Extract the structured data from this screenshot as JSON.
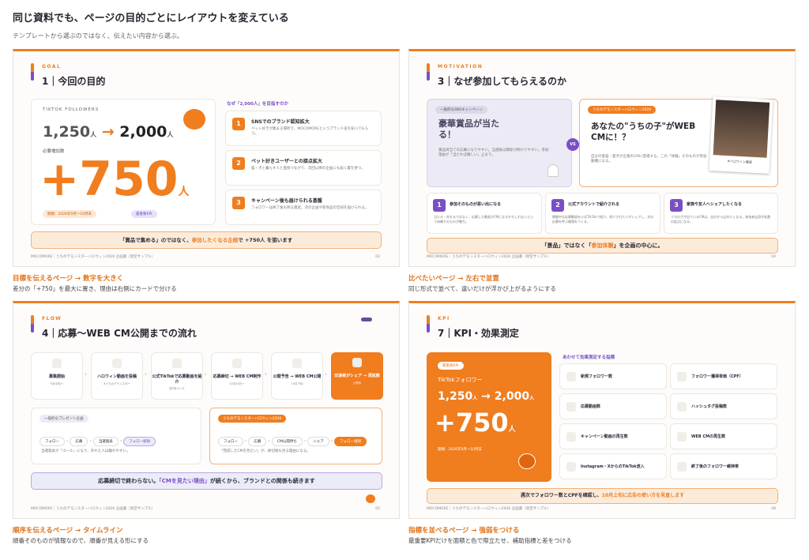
{
  "header": {
    "title": "同じ資料でも、ページの目的ごとにレイアウトを変えている",
    "subtitle": "テンプレートから選ぶのではなく、伝えたい内容から選ぶ。"
  },
  "footer": "MOCOMORE｜うちのデモンスターハロウィン2026 企画書（架空サンプル）",
  "s1": {
    "kicker": "GOAL",
    "title": "1｜今回の目的",
    "label": "TIKTOK FOLLOWERS",
    "from": "1,250",
    "unit": "人",
    "to": "2,000",
    "need_label": "必要増加数",
    "big": "+750",
    "period": "期間：2026年9月〜10月末",
    "kpi": "最重要KPI",
    "reasons_title": "なぜ「2,000人」を目指すのか",
    "items": [
      {
        "n": "1",
        "t": "SNSでのブランド認知拡大",
        "d": "ペット好きが集まる場所で、MOCOMOREというブランド名を知ってもらう。"
      },
      {
        "n": "2",
        "t": "ペット好きユーザーとの接点拡大",
        "d": "猫・犬と暮らす人と直接つながり、次回以降の企画にも届く層を持つ。"
      },
      {
        "n": "3",
        "t": "キャンペーン後も届けられる基盤",
        "d": "フォロワーは終了後も残る資産。次の企画や新商品の告知を届けられる。"
      }
    ],
    "banner_a": "「賞品で集める」のではなく、",
    "banner_b": "参加したくなる企画",
    "banner_c": "で +750人 を狙います",
    "page": "02"
  },
  "s2": {
    "kicker": "MOTIVATION",
    "title": "3｜なぜ参加してもらえるのか",
    "left_pill": "一般的なSNSキャンペーン",
    "left_head": "豪華賞品が当たる！",
    "left_desc": "賞品目当ての応募になりやすい。当選後は関係が終わりやすい。参加理由が「当たれば嬉しい」止まり。",
    "vs": "VS",
    "right_pill": "うちのデモンスターハロウィン2026",
    "right_head": "あなたの\"うちの子\"がWEB CMに！？",
    "right_desc": "自分の愛猫・愛犬が企業のCMに登場する。この「体験」そのものが参加動機になる。",
    "photo_cap": "#ハロウィン審査",
    "items": [
      {
        "n": "1",
        "t": "参加そのものが思い出になる",
        "d": "当たる・外れるではなく、応募した動画がCMになるかもしれないという体験そのものが魅力。"
      },
      {
        "n": "2",
        "t": "公式アカウントで紹介される",
        "d": "期間中は応募動画を公式TikTokで紹介。紹介された人がシェアし、次の応募を呼ぶ循環をつくる。"
      },
      {
        "n": "3",
        "t": "家族や友人へシェアしたくなる",
        "d": "うちの子が出ているCMは、自分から広めたくなる。参加者自身が拡散の起点になる。"
      }
    ],
    "banner_a": "「景品」ではなく「",
    "banner_b": "参加体験",
    "banner_c": "」を企画の中心に。",
    "page": "04"
  },
  "s3": {
    "kicker": "FLOW",
    "title": "4｜応募〜WEB CM公開までの流れ",
    "steps": [
      {
        "t": "募集開始",
        "d": "9月中旬〜"
      },
      {
        "t": "ハロウィン動画を投稿",
        "d": "#うちのデモンスター"
      },
      {
        "t": "公式TikTokで応募動画を紹介",
        "d": "週3本ペース"
      },
      {
        "t": "応募締切 → WEB CM制作",
        "d": "10月20日〜"
      },
      {
        "t": "公開予告 → WEB CM公開",
        "d": "10月下旬"
      },
      {
        "t": "出演者がシェア → 再拡散",
        "d": "公開後"
      }
    ],
    "left_pill": "一般的なプレゼント企画",
    "left_chain": [
      "フォロー",
      "応募",
      "当選発表",
      "フォロー解除"
    ],
    "left_desc": "当選発表が「ゴール」になり、外れた人は離れやすい。",
    "right_pill": "うちのデモンスターハロウィン2026",
    "right_chain": [
      "フォロー",
      "応募",
      "CM公開待ち",
      "シェア",
      "フォロー継続"
    ],
    "right_desc": "「完成したCMを見たい」が、締切後も見る理由になる。",
    "banner_a": "応募締切で終わらない。",
    "banner_b": "「CMを見たい理由」",
    "banner_c": "が続くから、ブランドとの関係も続きます",
    "page": "05"
  },
  "s4": {
    "kicker": "KPI",
    "title": "7｜KPI・効果測定",
    "pill": "最重要KPI",
    "label": "TikTokフォロワー",
    "from": "1,250",
    "unit": "人",
    "to": "2,000",
    "big": "+750",
    "period": "期間：2026年9月〜10月末",
    "sub_title": "あわせて効果測定する指標",
    "metrics": [
      "新規フォロワー数",
      "フォロワー獲得単価（CPF）",
      "応募動画数",
      "ハッシュタグ投稿数",
      "キャンペーン動画の再生数",
      "WEB CMの再生数",
      "Instagram・XからのTikTok流入",
      "終了後のフォロワー維持率"
    ],
    "banner_a": "週次でフォロワー数とCPFを確認し、",
    "banner_b": "10月上旬に広告の使い方を見直します",
    "page": "08"
  },
  "captions": [
    {
      "t": "目標を伝えるページ → 数字を大きく",
      "s": "差分の「+750」を最大に置き、理由は右側にカードで分ける"
    },
    {
      "t": "比べたいページ → 左右で並置",
      "s": "同じ形式で並べて、違いだけが浮かび上がるようにする"
    },
    {
      "t": "順序を伝えるページ → タイムライン",
      "s": "順番そのものが情報なので、順番が見える形にする"
    },
    {
      "t": "指標を並べるページ → 強弱をつける",
      "s": "最重要KPIだけを面積と色で際立たせ、補助指標と差をつける"
    }
  ],
  "colors": {
    "accent": "#f07d1e",
    "purple": "#7a4fc5"
  },
  "icons": [
    "pumpkin-icon",
    "ghost-icon",
    "bat-icon",
    "chart-icon",
    "video-icon",
    "play-icon"
  ]
}
